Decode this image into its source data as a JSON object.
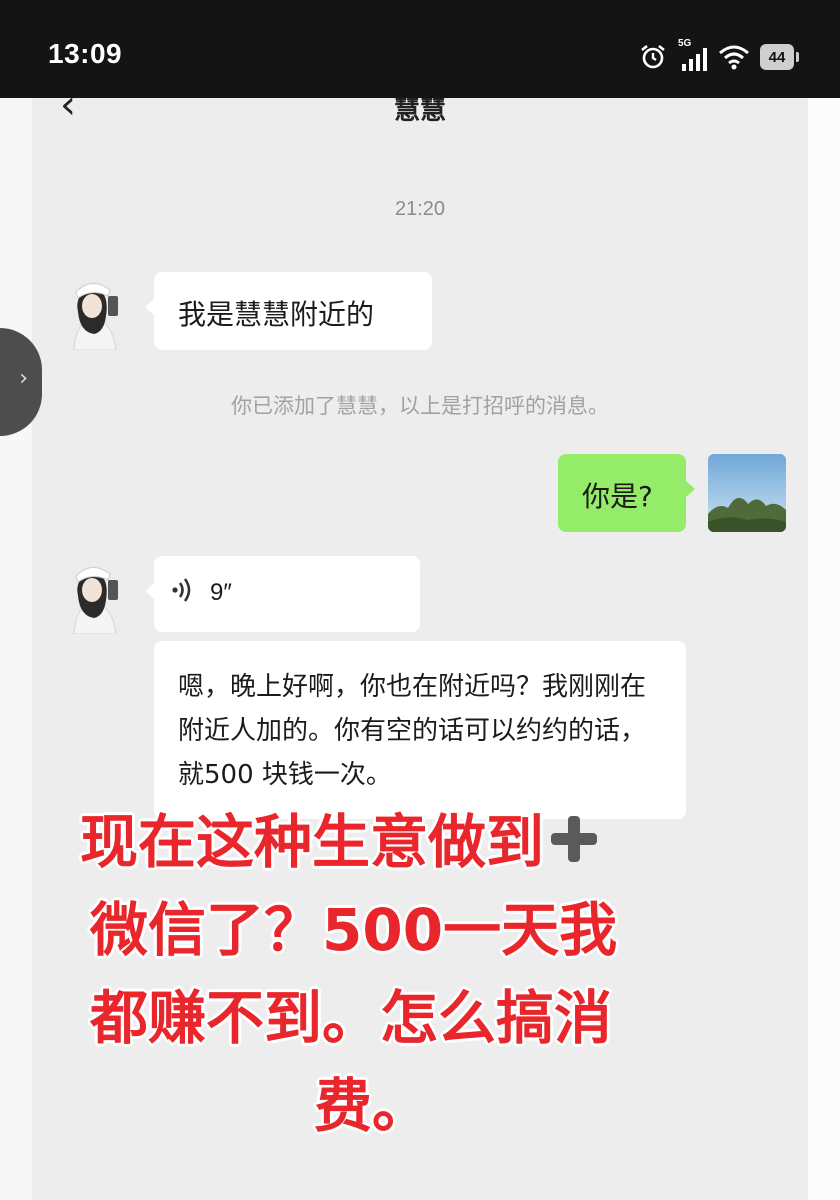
{
  "status": {
    "time": "13:09",
    "network": "5G",
    "battery": "44",
    "icons": [
      "alarm-icon",
      "signal-icon",
      "wifi-icon",
      "battery-icon"
    ]
  },
  "header": {
    "title": "慧慧",
    "back_icon": "chevron-left-icon",
    "more_icon": "more-dots-icon"
  },
  "chat": {
    "time_label": "21:20",
    "msg1": "我是慧慧附近的",
    "system_note": "你已添加了慧慧，以上是打招呼的消息。",
    "msg2": "你是?",
    "voice_duration": "9″",
    "msg3": "嗯，晚上好啊，你也在附近吗？我刚刚在附近人加的。你有空的话可以约约的话，就500 块钱一次。"
  },
  "overlay": {
    "line1": "现在这种生意做到",
    "line2": "微信了？500一天我",
    "line3": "都赚不到。怎么搞消",
    "line4": "费。"
  },
  "colors": {
    "chat_bg": "#ededed",
    "self_bubble": "#95ec69",
    "overlay_text": "#e8262b"
  }
}
